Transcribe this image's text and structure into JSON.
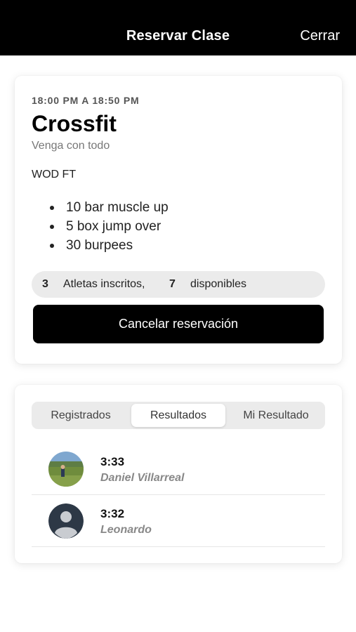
{
  "header": {
    "title": "Reservar Clase",
    "close_label": "Cerrar"
  },
  "class_card": {
    "time_range": "18:00 PM A 18:50 PM",
    "name": "Crossfit",
    "subtitle": "Venga con todo",
    "wod_title": "WOD FT",
    "wod_items": [
      "10 bar muscle up",
      "5 box jump over",
      "30 burpees"
    ],
    "enrolled_count": "3",
    "enrolled_label": "Atletas inscritos,",
    "available_count": "7",
    "available_label": "disponibles",
    "cancel_label": "Cancelar reservación"
  },
  "results_card": {
    "tabs": [
      {
        "label": "Registrados",
        "active": false
      },
      {
        "label": "Resultados",
        "active": true
      },
      {
        "label": "Mi Resultado",
        "active": false
      }
    ],
    "results": [
      {
        "time": "3:33",
        "name": "Daniel Villarreal",
        "avatar": "photo-avatar"
      },
      {
        "time": "3:32",
        "name": "Leonardo",
        "avatar": "default-person-avatar"
      }
    ]
  },
  "colors": {
    "header_bg": "#000000",
    "button_bg": "#000000",
    "pill_bg": "#ebebeb",
    "muted_text": "#888888"
  }
}
